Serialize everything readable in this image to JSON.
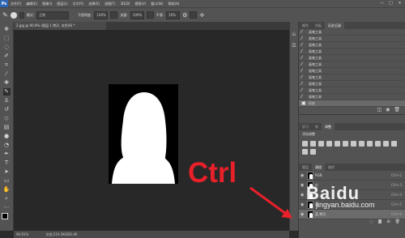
{
  "app": {
    "logo": "Ps"
  },
  "menubar": {
    "items": [
      "文件(F)",
      "编辑(E)",
      "图像(I)",
      "图层(L)",
      "文字(Y)",
      "选择(S)",
      "滤镜(T)",
      "3D(D)",
      "视图(V)",
      "窗口(W)",
      "帮助(H)"
    ]
  },
  "window_controls": {
    "minimize": "—",
    "maximize": "□",
    "close": "✕"
  },
  "options": {
    "mode_label": "模式:",
    "mode_value": "正常",
    "opacity_label": "不透明度:",
    "opacity_value": "100%",
    "flow_label": "流量:",
    "flow_value": "100%",
    "smooth_label": "平滑:",
    "smooth_value": "10%"
  },
  "tools": [
    "move-icon",
    "marquee-icon",
    "lasso-icon",
    "quick-select-icon",
    "crop-icon",
    "eyedropper-icon",
    "healing-icon",
    "brush-icon",
    "stamp-icon",
    "history-brush-icon",
    "eraser-icon",
    "gradient-icon",
    "blur-icon",
    "dodge-icon",
    "pen-icon",
    "type-icon",
    "path-select-icon",
    "shape-icon",
    "hand-icon",
    "zoom-icon",
    "more-icon"
  ],
  "document": {
    "tab_title": "2.jpg @ 90.9% (图层 1 拷贝, 灰色/8) *",
    "status_zoom": "90.91%",
    "status_doc": "文档:219.3K/830.4K"
  },
  "history": {
    "tabs": [
      "颜色",
      "色板",
      "历史记录"
    ],
    "items": [
      "画笔工具",
      "画笔工具",
      "画笔工具",
      "画笔工具",
      "画笔工具",
      "画笔工具",
      "画笔工具",
      "画笔工具",
      "画笔工具",
      "画笔工具",
      "画笔工具"
    ],
    "last_item": "历史"
  },
  "adjustments": {
    "tabs": [
      "学习",
      "库",
      "调整"
    ],
    "title": "添加调整"
  },
  "layers": {
    "tabs": [
      "图层",
      "通道",
      "路径"
    ],
    "rows": [
      {
        "name": "RGB",
        "shortcut": "Ctrl+2"
      },
      {
        "name": "红",
        "shortcut": "Ctrl+3"
      },
      {
        "name": "绿",
        "shortcut": "Ctrl+4"
      },
      {
        "name": "蓝",
        "shortcut": "Ctrl+5"
      },
      {
        "name": "蓝 拷贝",
        "shortcut": "Ctrl+6"
      }
    ]
  },
  "overlay": {
    "ctrl_label": "Ctrl",
    "watermark_logo": "Baidu",
    "watermark_url": "jingyan.baidu.com"
  }
}
